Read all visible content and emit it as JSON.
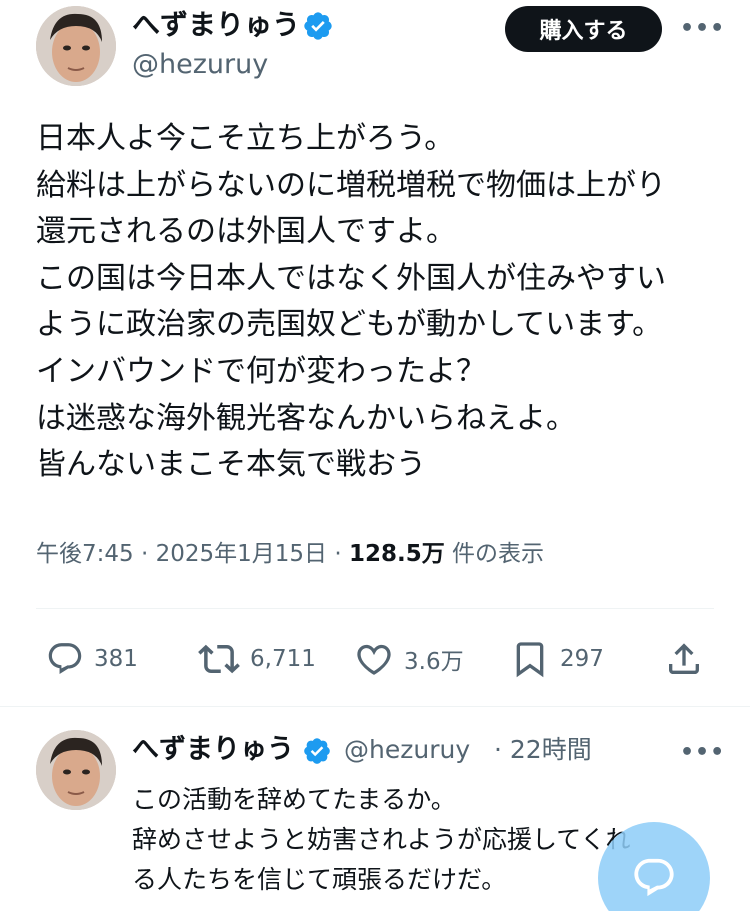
{
  "tweet": {
    "author_name": "へずまりゅう",
    "author_handle": "@hezuruy",
    "buy_button": "購入する",
    "lines": [
      "日本人よ今こそ立ち上がろう。",
      "給料は上がらないのに増税増税で物価は上がり",
      "還元されるのは外国人ですよ。",
      "この国は今日本人ではなく外国人が住みやすい",
      "ように政治家の売国奴どもが動かしています。",
      "インバウンドで何が変わったよ？",
      "は迷惑な海外観光客なんかいらねえよ。",
      "皆んないまこそ本気で戦おう"
    ],
    "time_date": "午後7:45 · 2025年1月15日 · ",
    "views": "128.5万",
    "views_suffix": " 件の表示",
    "stats": {
      "replies": "381",
      "reposts": "6,711",
      "likes": "3.6万",
      "bookmarks": "297"
    }
  },
  "reply": {
    "author_name": "へずまりゅう",
    "author_handle": "@hezuruy",
    "time": "· 22時間",
    "lines": [
      "この活動を辞めてたまるか。",
      "辞めさせようと妨害されようが応援してくれ",
      "る人たちを信じて頑張るだけだ。"
    ]
  },
  "colors": {
    "verified": "#1d9bf0",
    "text": "#0f1419",
    "secondary": "#536471",
    "fab": "#8ecdf8"
  },
  "icons": [
    "verified-badge-icon",
    "more-icon",
    "reply-icon",
    "repost-icon",
    "like-icon",
    "bookmark-icon",
    "share-icon",
    "compose-reply-icon"
  ]
}
